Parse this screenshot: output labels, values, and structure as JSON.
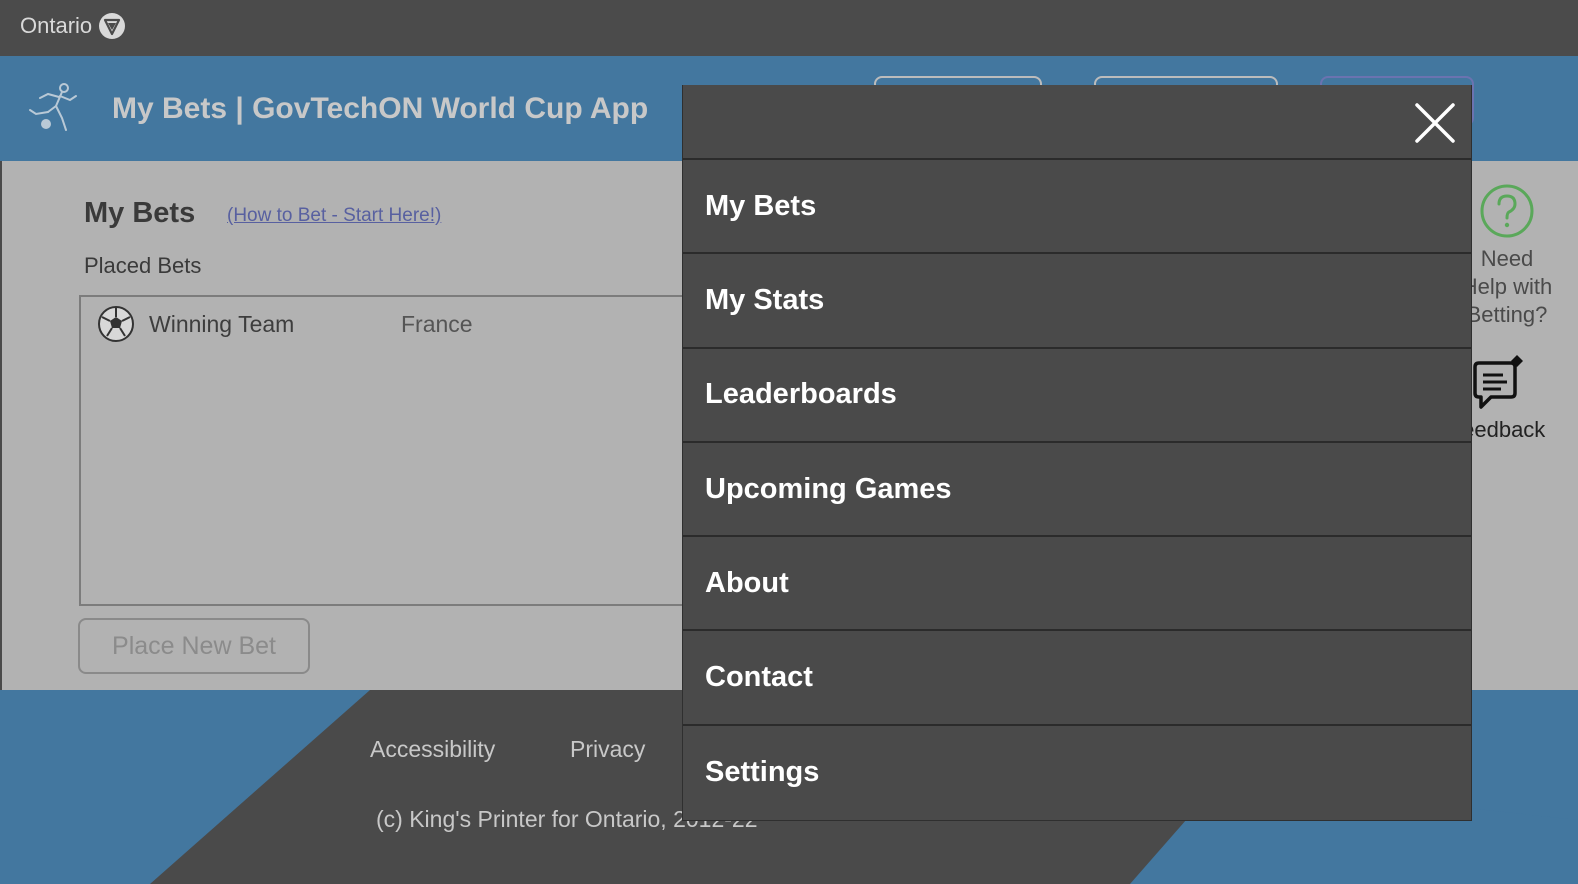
{
  "ontario": {
    "brand": "Ontario"
  },
  "header": {
    "title": "My Bets | GovTechON World Cup App"
  },
  "main": {
    "heading": "My Bets",
    "how_to_link": "(How to Bet - Start Here!)",
    "placed_label": "Placed Bets",
    "bets": [
      {
        "type": "Winning Team",
        "value": "France"
      }
    ],
    "place_bet_label": "Place New Bet",
    "help_text_lines": [
      "Need",
      "Help with",
      "Betting?"
    ],
    "feedback_label": "Feedback"
  },
  "footer": {
    "links": [
      "Accessibility",
      "Privacy"
    ],
    "copyright": "(c) King's Printer for Ontario, 2012-22"
  },
  "menu": {
    "items": [
      "My Bets",
      "My Stats",
      "Leaderboards",
      "Upcoming Games",
      "About",
      "Contact",
      "Settings"
    ]
  },
  "colors": {
    "header_blue": "#43779f",
    "menu_bg": "#4a4a4a",
    "help_green": "#5aa85a"
  }
}
